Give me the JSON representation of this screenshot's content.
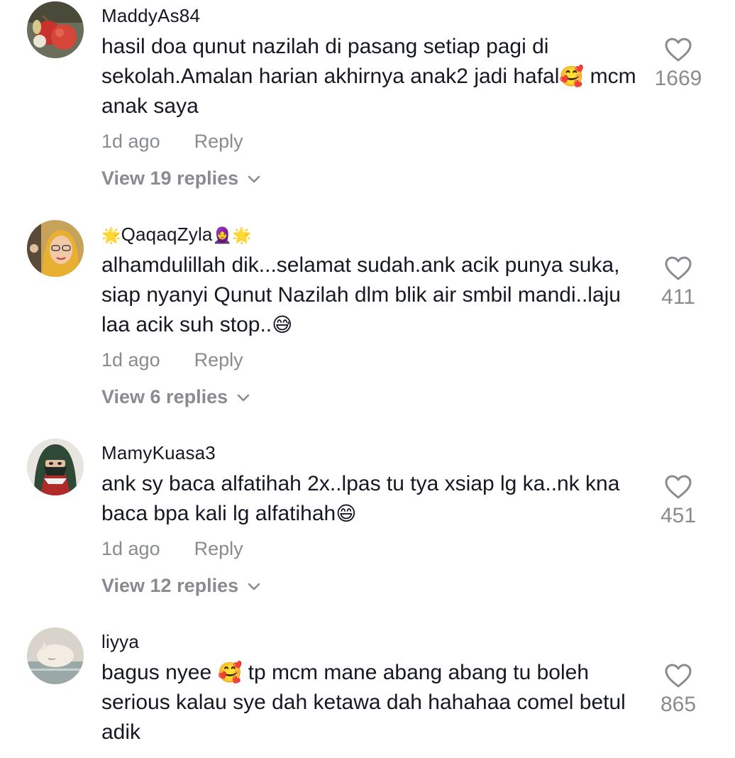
{
  "comments": [
    {
      "username": "MaddyAs84",
      "text_before": "hasil doa qunut nazilah di pasang setiap pagi di sekolah.Amalan harian akhirnya anak2 jadi hafal",
      "emoji": "🥰",
      "text_after": " mcm anak saya",
      "time": "1d ago",
      "reply_label": "Reply",
      "view_replies": "View 19 replies",
      "likes": "1669",
      "avatar": "red-apples"
    },
    {
      "username_prefix": "🌟",
      "username": "QaqaqZyla",
      "username_suffix": "🧕🌟",
      "text_before": "alhamdulillah dik...selamat sudah.ank acik punya suka, siap nyanyi Qunut Nazilah dlm blik air smbil mandi..laju laa acik suh stop..",
      "emoji": "😅",
      "text_after": "",
      "time": "1d ago",
      "reply_label": "Reply",
      "view_replies": "View 6 replies",
      "likes": "411",
      "avatar": "woman-hijab-glasses"
    },
    {
      "username": "MamyKuasa3",
      "text_before": "ank sy baca alfatihah 2x..lpas tu tya xsiap lg ka..nk kna baca bpa kali lg alfatihah",
      "emoji": "😄",
      "text_after": "",
      "time": "1d ago",
      "reply_label": "Reply",
      "view_replies": "View 12 replies",
      "likes": "451",
      "avatar": "woman-niqab"
    },
    {
      "username": "liyya",
      "text_before": "bagus nyee ",
      "emoji": "🥰",
      "text_after": " tp mcm mane abang abang tu boleh serious kalau sye dah ketawa dah hahahaa comel betul adik",
      "likes": "865",
      "avatar": "sleeping-cat"
    }
  ],
  "icons": {
    "heart": "heart-outline-icon",
    "chevron": "chevron-down-icon"
  },
  "colors": {
    "text": "#161823",
    "muted": "#8a8b91",
    "background": "#ffffff"
  }
}
